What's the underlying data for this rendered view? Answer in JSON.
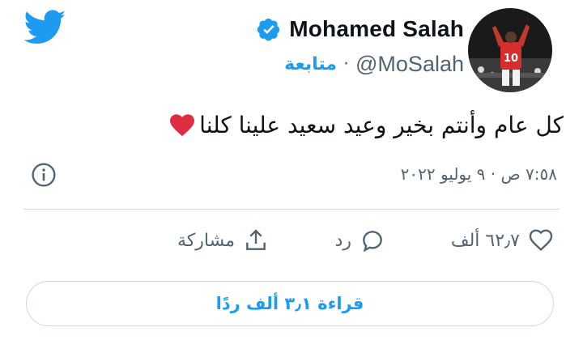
{
  "header": {
    "logo_icon": "twitter-bird-icon",
    "display_name": "Mohamed Salah",
    "verified_icon": "verified-badge-icon",
    "handle": "@MoSalah",
    "separator": "·",
    "follow_label": "متابعة",
    "avatar_icon": "avatar"
  },
  "tweet": {
    "text": "كل عام وأنتم بخير وعيد سعيد علينا كلنا",
    "emoji": "red-heart-icon",
    "timestamp": "٧:٥٨ ص · ٩ يوليو ٢٠٢٢"
  },
  "actions": {
    "like_count": "٦٢٫٧ ألف",
    "reply_label": "رد",
    "share_label": "مشاركة"
  },
  "footer": {
    "read_replies_label": "قراءة ٣٫١ ألف ردًا"
  },
  "colors": {
    "brand_blue": "#1d9bf0",
    "muted": "#536471",
    "heart": "#e0245e"
  }
}
